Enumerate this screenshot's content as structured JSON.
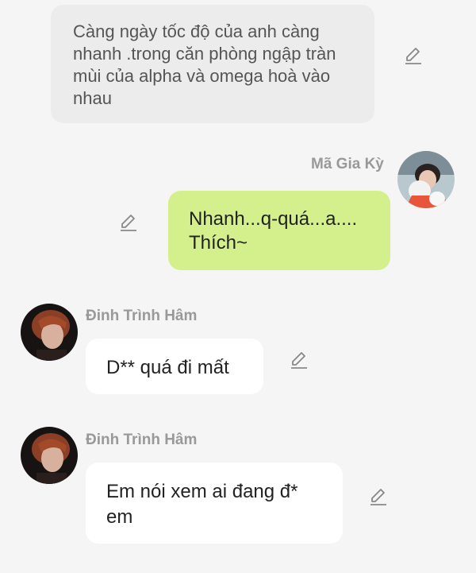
{
  "messages": [
    {
      "type": "narration",
      "text": "Càng ngày tốc độ của anh càng nhanh .trong căn phòng ngập tràn mùi của alpha và omega hoà vào nhau"
    },
    {
      "type": "outgoing",
      "sender": "Mã Gia Kỳ",
      "text": "Nhanh...q-quá...a.... Thích~"
    },
    {
      "type": "incoming",
      "sender": "Đinh Trình Hâm",
      "text": "D** quá đi mất"
    },
    {
      "type": "incoming",
      "sender": "Đinh Trình Hâm",
      "text": "Em nói xem ai đang đ* em"
    }
  ],
  "icons": {
    "edit": "pencil-edit-icon",
    "avatar": "user-avatar"
  },
  "colors": {
    "outgoing_bubble": "#d4f08c",
    "incoming_bubble": "#ffffff",
    "narration_bubble": "#ececec",
    "background": "#f5f5f5",
    "sender_name": "#999999"
  }
}
